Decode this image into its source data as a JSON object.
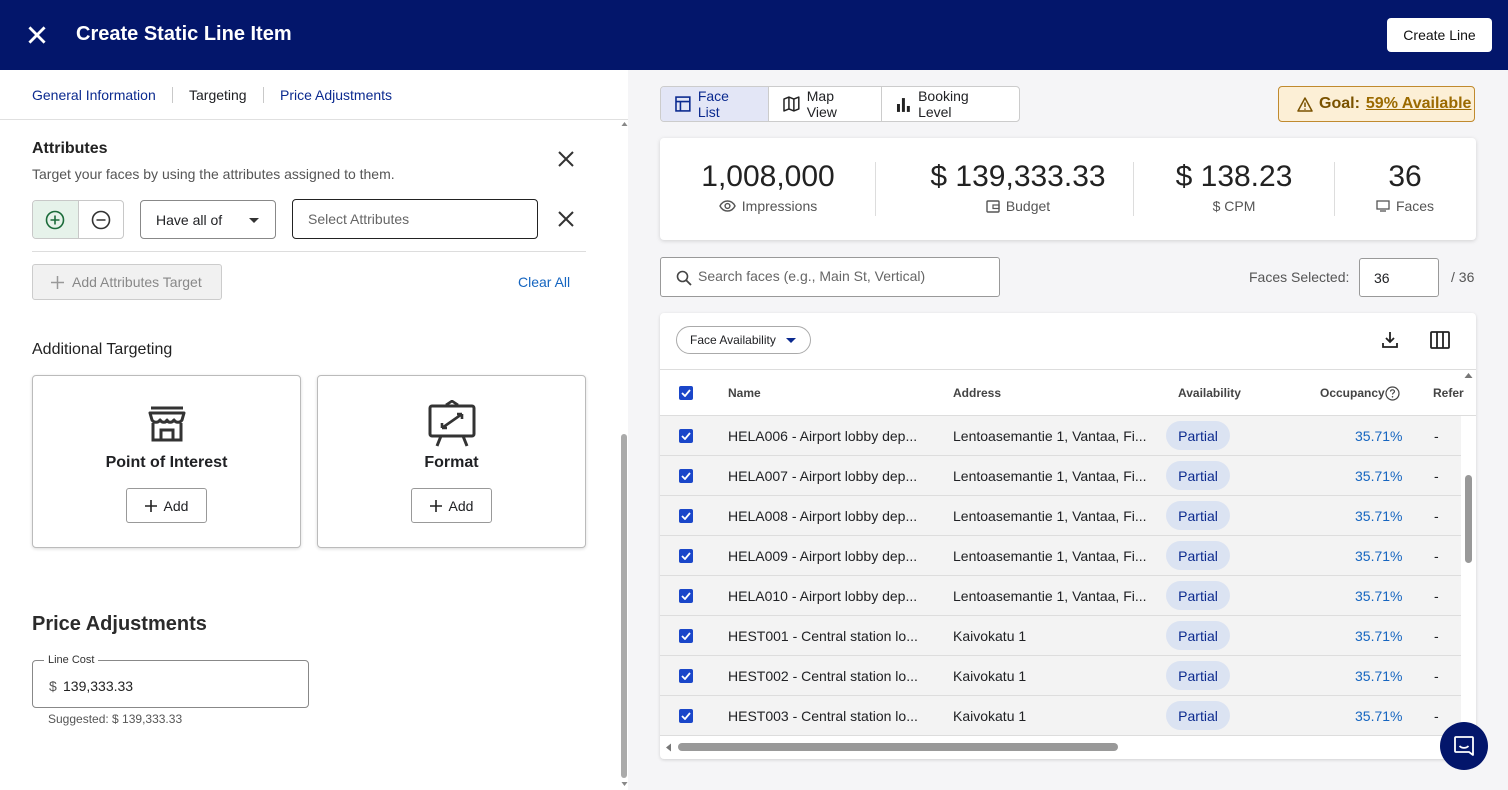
{
  "header": {
    "title": "Create Static Line Item",
    "create_label": "Create Line"
  },
  "tabs": [
    "General Information",
    "Targeting",
    "Price Adjustments"
  ],
  "attributes": {
    "title": "Attributes",
    "subtitle": "Target your faces by using the attributes assigned to them.",
    "match_mode": "Have all of",
    "select_placeholder": "Select Attributes",
    "add_target_label": "Add Attributes Target",
    "clear_all_label": "Clear All"
  },
  "additional_targeting": {
    "title": "Additional Targeting",
    "cards": [
      {
        "title": "Point of Interest",
        "add_label": "Add",
        "icon": "storefront-icon"
      },
      {
        "title": "Format",
        "add_label": "Add",
        "icon": "billboard-icon"
      }
    ]
  },
  "price_adjustments": {
    "title": "Price Adjustments",
    "line_cost_label": "Line Cost",
    "currency": "$",
    "line_cost_value": "139,333.33",
    "suggested": "Suggested: $ 139,333.33"
  },
  "views": [
    "Face List",
    "Map View",
    "Booking Level"
  ],
  "goal": {
    "label": "Goal:",
    "value": "59% Available"
  },
  "stats": [
    {
      "value": "1,008,000",
      "label": "Impressions"
    },
    {
      "value": "$ 139,333.33",
      "label": "Budget"
    },
    {
      "value": "$ 138.23",
      "label": "$ CPM"
    },
    {
      "value": "36",
      "label": "Faces"
    }
  ],
  "search": {
    "placeholder": "Search faces (e.g., Main St, Vertical)"
  },
  "faces_selected": {
    "label": "Faces Selected:",
    "value": "36",
    "total": "/ 36"
  },
  "table": {
    "filter_label": "Face Availability",
    "columns": [
      "Name",
      "Address",
      "Availability",
      "Occupancy",
      "Refer"
    ],
    "rows": [
      {
        "name": "HELA006 - Airport lobby dep...",
        "address": "Lentoasemantie 1, Vantaa, Fi...",
        "availability": "Partial",
        "occupancy": "35.71%",
        "ref": "-"
      },
      {
        "name": "HELA007 - Airport lobby dep...",
        "address": "Lentoasemantie 1, Vantaa, Fi...",
        "availability": "Partial",
        "occupancy": "35.71%",
        "ref": "-"
      },
      {
        "name": "HELA008 - Airport lobby dep...",
        "address": "Lentoasemantie 1, Vantaa, Fi...",
        "availability": "Partial",
        "occupancy": "35.71%",
        "ref": "-"
      },
      {
        "name": "HELA009 - Airport lobby dep...",
        "address": "Lentoasemantie 1, Vantaa, Fi...",
        "availability": "Partial",
        "occupancy": "35.71%",
        "ref": "-"
      },
      {
        "name": "HELA010 - Airport lobby dep...",
        "address": "Lentoasemantie 1, Vantaa, Fi...",
        "availability": "Partial",
        "occupancy": "35.71%",
        "ref": "-"
      },
      {
        "name": "HEST001 - Central station lo...",
        "address": "Kaivokatu 1",
        "availability": "Partial",
        "occupancy": "35.71%",
        "ref": "-"
      },
      {
        "name": "HEST002 - Central station lo...",
        "address": "Kaivokatu 1",
        "availability": "Partial",
        "occupancy": "35.71%",
        "ref": "-"
      },
      {
        "name": "HEST003 - Central station lo...",
        "address": "Kaivokatu 1",
        "availability": "Partial",
        "occupancy": "35.71%",
        "ref": "-"
      }
    ]
  },
  "colors": {
    "header": "#03166b",
    "accent": "#1a46c9",
    "link": "#1565c0",
    "goal_bg": "#fcefd6"
  }
}
